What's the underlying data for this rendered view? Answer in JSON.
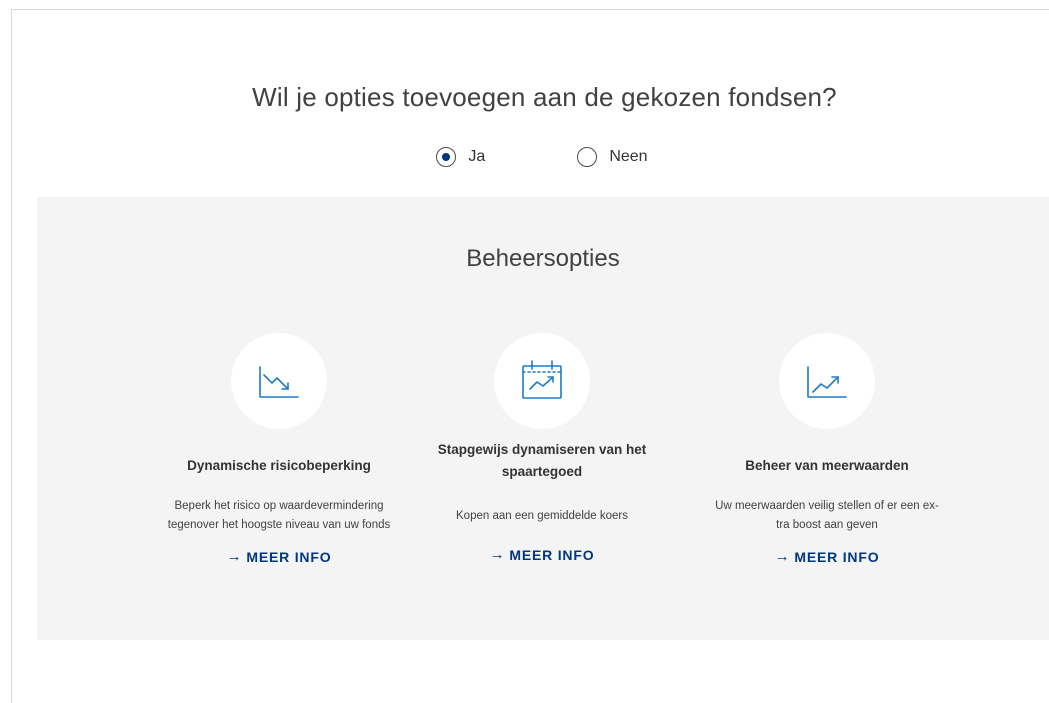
{
  "question": "Wil je opties toevoegen aan de gekozen fondsen?",
  "options": {
    "yes_label": "Ja",
    "no_label": "Neen",
    "selected": "Ja"
  },
  "panel": {
    "title": "Beheersopties",
    "cards": [
      {
        "icon": "chart-down-icon",
        "title": "Dynamische risicobeperking",
        "desc_line1": "Beperk het risico op waardevermindering",
        "desc_line2": "tegenover het hoogste niveau van uw fonds",
        "link": "MEER INFO"
      },
      {
        "icon": "calendar-chart-icon",
        "title_line1": "Stapgewijs dynamiseren van het",
        "title_line2": "spaartegoed",
        "desc": "Kopen aan een gemiddelde koers",
        "link": "MEER INFO"
      },
      {
        "icon": "chart-up-icon",
        "title": "Beheer van meerwaarden",
        "desc_line1": "Uw meerwaarden veilig stellen of er een ex-",
        "desc_line2": "tra boost aan geven",
        "link": "MEER INFO"
      }
    ]
  },
  "colors": {
    "accent": "#003781",
    "icon": "#1f7ac7",
    "panel_bg": "#f4f4f4"
  }
}
